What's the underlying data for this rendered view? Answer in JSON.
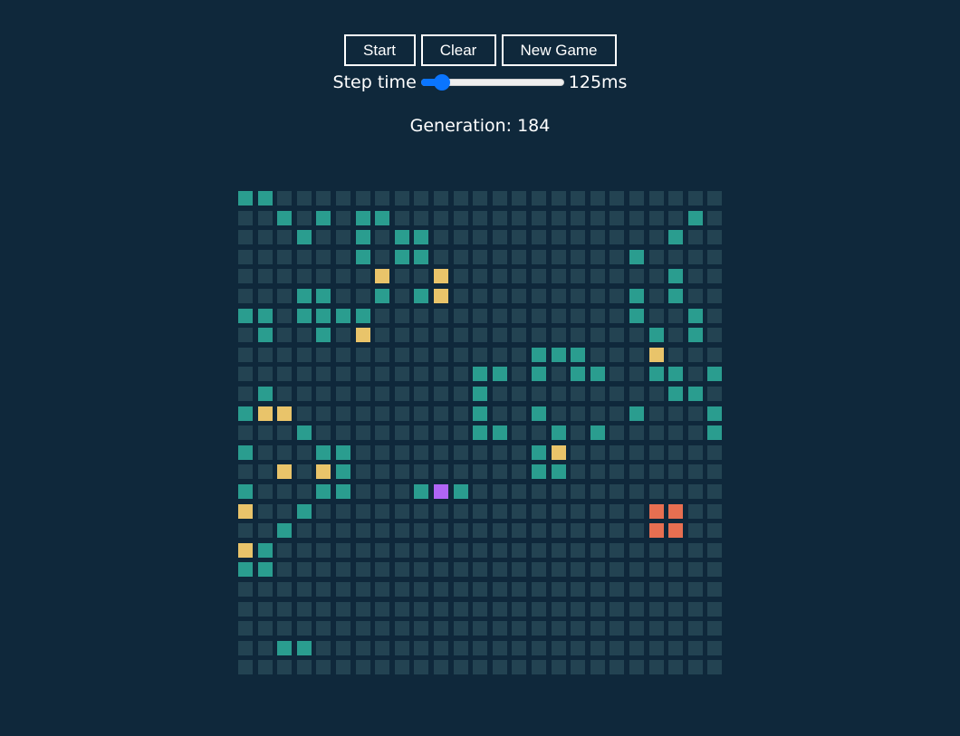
{
  "controls": {
    "start_label": "Start",
    "clear_label": "Clear",
    "new_game_label": "New Game"
  },
  "speed": {
    "label": "Step time",
    "value_text": "125ms",
    "slider_fraction": 0.1
  },
  "generation": {
    "text": "Generation: 184"
  },
  "board": {
    "size": 25,
    "colors": {
      "empty": "#234352",
      "teal": "#2a9d8f",
      "yellow": "#e9c46a",
      "orange": "#e76f51",
      "purple": "#b065f5"
    },
    "grid": [
      "TT.......................",
      "..T.T.TT...............T",
      "...T..T.TT............T.",
      "......T.TT..........T...",
      ".......Y..Y...........T.",
      "...TT..T.TY.........T.T.",
      "TT.TTTT.............T..T",
      ".T..T.Y..............T.T",
      "...............TTT...Y..",
      "............TT.T.TT..TT.T",
      ".T..........T.........TT",
      "TYY.........T..T....T...T",
      "...T........TT..T.T.....T",
      "T...TT.........TY........",
      "..Y.YT.........TT........",
      "T...TT...TPT.............",
      "Y..T.................OO..",
      "..T..................OO..",
      "YT.......................",
      "TT.......................",
      ".........................",
      ".........................",
      ".........................",
      "..TT.....................",
      "........................."
    ]
  }
}
